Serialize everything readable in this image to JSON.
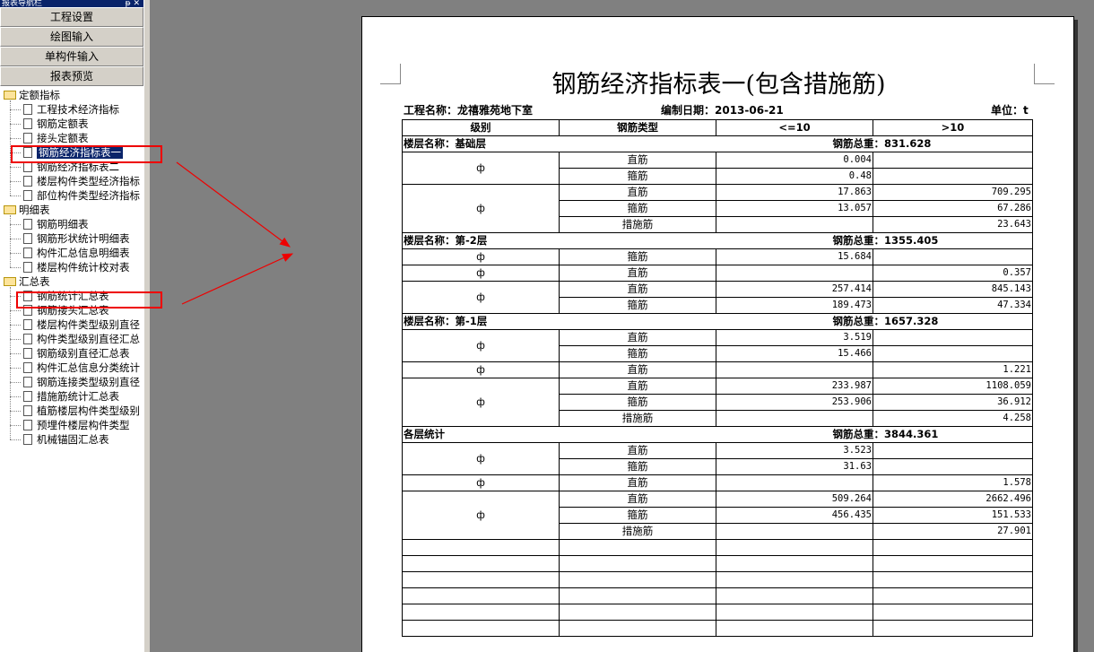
{
  "nav": {
    "panel_title": "报表导航栏",
    "buttons": [
      "工程设置",
      "绘图输入",
      "单构件输入",
      "报表预览"
    ],
    "groups": [
      {
        "label": "定额指标",
        "items": [
          "工程技术经济指标",
          "钢筋定额表",
          "接头定额表",
          "钢筋经济指标表一",
          "钢筋经济指标表二",
          "楼层构件类型经济指标",
          "部位构件类型经济指标"
        ]
      },
      {
        "label": "明细表",
        "items": [
          "钢筋明细表",
          "钢筋形状统计明细表",
          "构件汇总信息明细表",
          "楼层构件统计校对表"
        ]
      },
      {
        "label": "汇总表",
        "items": [
          "钢筋统计汇总表",
          "钢筋接头汇总表",
          "楼层构件类型级别直径",
          "构件类型级别直径汇总",
          "钢筋级别直径汇总表",
          "构件汇总信息分类统计",
          "钢筋连接类型级别直径",
          "措施筋统计汇总表",
          "植筋楼层构件类型级别",
          "预埋件楼层构件类型",
          "机械锚固汇总表"
        ]
      }
    ],
    "selected_item": "钢筋经济指标表一"
  },
  "report": {
    "title": "钢筋经济指标表一(包含措施筋)",
    "project_label": "工程名称：龙禧雅苑地下室",
    "date_label": "编制日期：2013-06-21",
    "unit_label": "单位：t",
    "headers": [
      "级别",
      "钢筋类型",
      "<=10",
      ">10"
    ],
    "sections": [
      {
        "name": "楼层名称：基础层",
        "total": "钢筋总重：831.628",
        "groups": [
          {
            "grade": "ф",
            "rows": [
              [
                "直筋",
                "0.004",
                ""
              ],
              [
                "箍筋",
                "0.48",
                ""
              ]
            ]
          },
          {
            "grade": "ф",
            "rows": [
              [
                "直筋",
                "17.863",
                "709.295"
              ],
              [
                "箍筋",
                "13.057",
                "67.286"
              ],
              [
                "措施筋",
                "",
                "23.643"
              ]
            ]
          }
        ]
      },
      {
        "name": "楼层名称：第-2层",
        "total": "钢筋总重：1355.405",
        "groups": [
          {
            "grade": "ф",
            "rows": [
              [
                "箍筋",
                "15.684",
                ""
              ]
            ]
          },
          {
            "grade": "ф",
            "rows": [
              [
                "直筋",
                "",
                "0.357"
              ]
            ]
          },
          {
            "grade": "ф",
            "rows": [
              [
                "直筋",
                "257.414",
                "845.143"
              ],
              [
                "箍筋",
                "189.473",
                "47.334"
              ]
            ]
          }
        ]
      },
      {
        "name": "楼层名称：第-1层",
        "total": "钢筋总重：1657.328",
        "groups": [
          {
            "grade": "ф",
            "rows": [
              [
                "直筋",
                "3.519",
                ""
              ],
              [
                "箍筋",
                "15.466",
                ""
              ]
            ]
          },
          {
            "grade": "ф",
            "rows": [
              [
                "直筋",
                "",
                "1.221"
              ]
            ]
          },
          {
            "grade": "ф",
            "rows": [
              [
                "直筋",
                "233.987",
                "1108.059"
              ],
              [
                "箍筋",
                "253.906",
                "36.912"
              ],
              [
                "措施筋",
                "",
                "4.258"
              ]
            ]
          }
        ]
      },
      {
        "name": "各层统计",
        "total": "钢筋总重：3844.361",
        "groups": [
          {
            "grade": "ф",
            "rows": [
              [
                "直筋",
                "3.523",
                ""
              ],
              [
                "箍筋",
                "31.63",
                ""
              ]
            ]
          },
          {
            "grade": "ф",
            "rows": [
              [
                "直筋",
                "",
                "1.578"
              ]
            ]
          },
          {
            "grade": "ф",
            "rows": [
              [
                "直筋",
                "509.264",
                "2662.496"
              ],
              [
                "箍筋",
                "456.435",
                "151.533"
              ],
              [
                "措施筋",
                "",
                "27.901"
              ]
            ]
          }
        ]
      }
    ]
  },
  "annotation_color": "#e00000"
}
